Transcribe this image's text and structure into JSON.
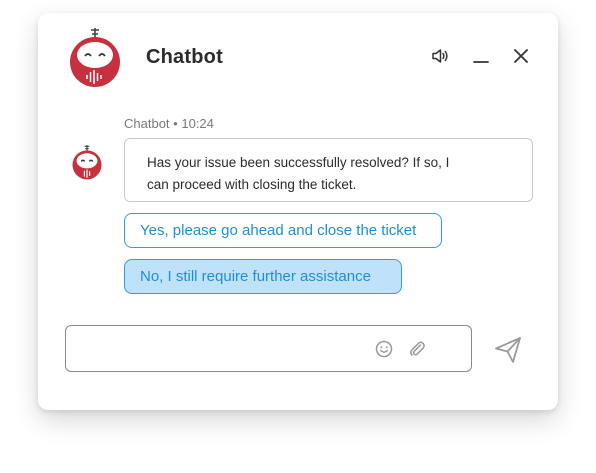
{
  "header": {
    "title": "Chatbot",
    "icons": {
      "avatar": "robot-icon",
      "sound": "speaker-icon",
      "minimize": "minimize-icon",
      "close": "close-icon"
    }
  },
  "message": {
    "sender": "Chatbot",
    "separator": "•",
    "time": "10:24",
    "text_line1": "Has your issue been successfully resolved? If so, I",
    "text_line2": "can proceed with closing the ticket."
  },
  "quick_replies": [
    {
      "label": "Yes, please go ahead and close the ticket",
      "selected": false
    },
    {
      "label": "No, I still require further assistance",
      "selected": true
    }
  ],
  "composer": {
    "value": "",
    "placeholder": "",
    "icons": {
      "emoji": "smiley-icon",
      "attach": "paperclip-icon",
      "send": "paper-plane-icon"
    }
  },
  "colors": {
    "brand_red": "#c7303f",
    "accent_blue": "#1d8fd6",
    "selected_fill": "#bfe2fa",
    "text": "#2b2b2b",
    "meta_text": "#7a7a7a"
  }
}
